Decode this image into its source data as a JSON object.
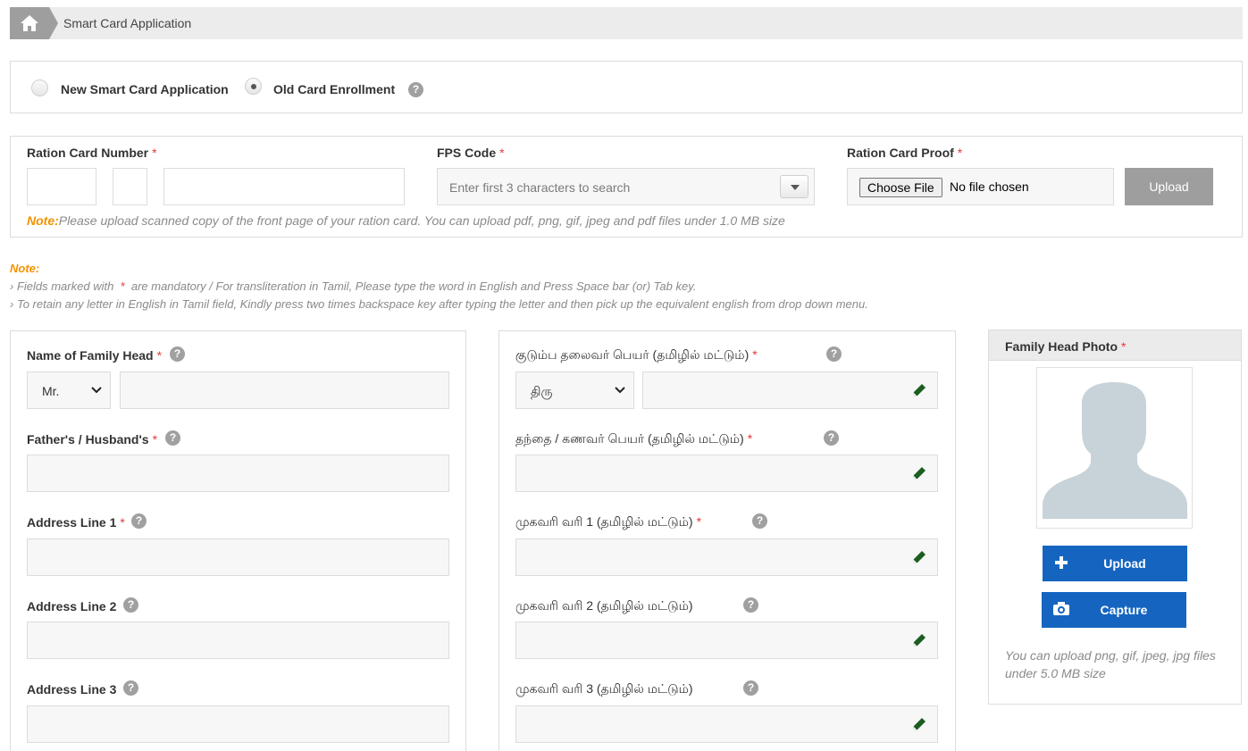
{
  "breadcrumb": {
    "home_icon": "home-icon",
    "current": "Smart Card Application"
  },
  "application_type": {
    "options": [
      {
        "label": "New Smart Card Application",
        "checked": false
      },
      {
        "label": "Old Card Enrollment",
        "checked": true
      }
    ],
    "help_icon": "?"
  },
  "ration_section": {
    "ration_card_number_label": "Ration Card Number",
    "fps_code_label": "FPS Code",
    "fps_code_placeholder": "Enter first 3 characters to search",
    "ration_card_proof_label": "Ration Card Proof",
    "choose_file_label": "Choose File",
    "no_file_text": "No file chosen",
    "upload_label": "Upload",
    "note_prefix": "Note:",
    "note_text": "Please upload scanned copy of the front page of your ration card. You can upload pdf, png, gif, jpeg and pdf files under 1.0 MB size"
  },
  "general_note": {
    "title": "Note:",
    "line1_a": "› Fields marked with",
    "line1_star": "*",
    "line1_b": "are mandatory  / For transliteration in Tamil, Please type the word in English and Press Space bar (or) Tab key.",
    "line2": "› To retain any letter in English in Tamil field, Kindly press two times backspace key after typing the letter and then pick up the equivalent english from drop down menu."
  },
  "english_fields": {
    "family_head_label": "Name of Family Head",
    "title_select_value": "Mr.",
    "father_label": "Father's / Husband's",
    "address1_label": "Address Line 1",
    "address2_label": "Address Line 2",
    "address3_label": "Address Line 3"
  },
  "tamil_fields": {
    "family_head_label": "குடும்ப தலைவர் பெயர் (தமிழில் மட்டும்)",
    "title_select_value": "திரு",
    "father_label": "தந்தை / கணவர் பெயர் (தமிழில் மட்டும்)",
    "address1_label": "முகவரி வரி 1 (தமிழில் மட்டும்)",
    "address2_label": "முகவரி வரி 2 (தமிழில் மட்டும்)",
    "address3_label": "முகவரி வரி 3 (தமிழில் மட்டும்)"
  },
  "required_mark": "*",
  "help_mark": "?",
  "photo": {
    "title": "Family Head Photo",
    "upload_label": "Upload",
    "capture_label": "Capture",
    "note_line1": "You can upload png, gif, jpeg, jpg files",
    "note_line2": "under 5.0 MB size"
  },
  "colors": {
    "primary_button": "#1565c0",
    "note_accent": "#f39200",
    "required": "#e53935",
    "pencil": "#1b5e20"
  }
}
